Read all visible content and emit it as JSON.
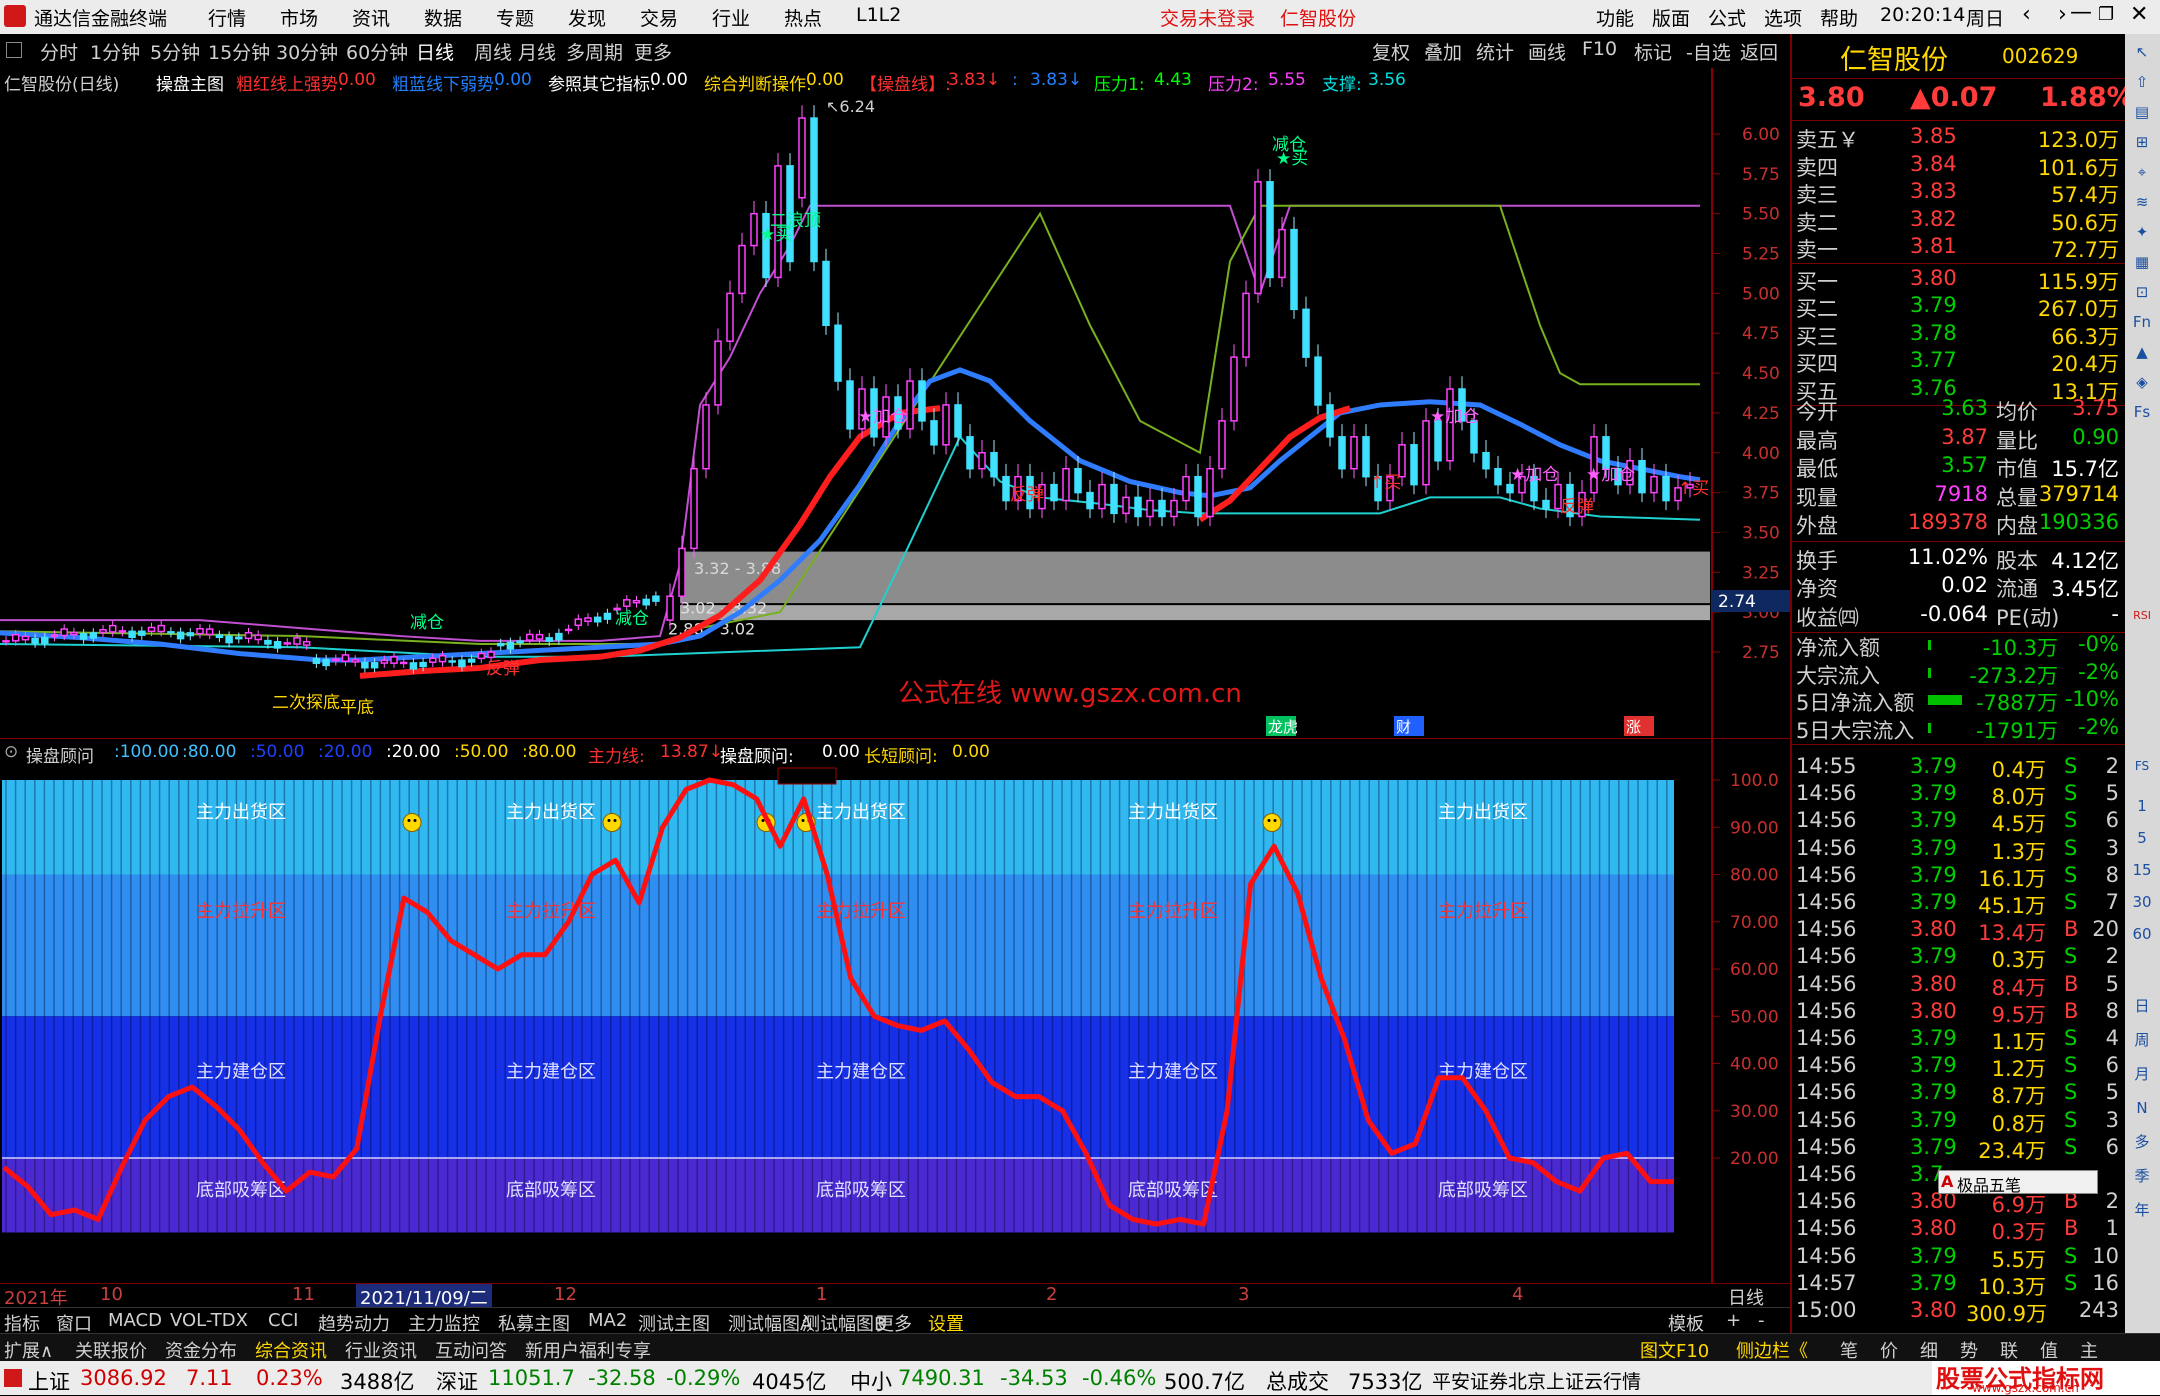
{
  "topbar": {
    "app_title": "通达信金融终端",
    "menus": [
      "行情",
      "市场",
      "资讯",
      "数据",
      "专题",
      "发现",
      "交易",
      "行业",
      "热点",
      "L1L2"
    ],
    "login_status": "交易未登录",
    "stock_title": "仁智股份",
    "right_menus": [
      "功能",
      "版面",
      "公式",
      "选项",
      "帮助"
    ],
    "time": "20:20:14",
    "weekday": "周日"
  },
  "periodbar": {
    "periods": [
      "分时",
      "1分钟",
      "5分钟",
      "15分钟",
      "30分钟",
      "60分钟",
      "日线",
      "周线",
      "月线",
      "多周期",
      "更多"
    ],
    "selected": "日线",
    "tools": [
      "复权",
      "叠加",
      "统计",
      "画线",
      "F10",
      "标记",
      "-自选",
      "返回"
    ]
  },
  "main_legend": {
    "stock": "仁智股份(日线)",
    "formula": "操盘主图",
    "items": [
      {
        "label": "粗红线上强势:",
        "value": "0.00",
        "color": "#ff3030"
      },
      {
        "label": "粗蓝线下弱势:",
        "value": "0.00",
        "color": "#2080ff"
      },
      {
        "label": "参照其它指标:",
        "value": "0.00",
        "color": "#ffffff"
      },
      {
        "label": "综合判断操作:",
        "value": "0.00",
        "color": "#ffd800"
      },
      {
        "label": "【操盘线】:",
        "value": "3.83↓",
        "color": "#ff3030"
      },
      {
        "label": ":",
        "value": "3.83↓",
        "color": "#2080ff"
      },
      {
        "label": "压力1:",
        "value": "4.43",
        "color": "#00ff00"
      },
      {
        "label": "压力2:",
        "value": "5.55",
        "color": "#ff40ff"
      },
      {
        "label": "支撑:",
        "value": "3.56",
        "color": "#00e0e0"
      }
    ]
  },
  "main_axis": {
    "ticks": [
      "6.00",
      "5.75",
      "5.50",
      "5.25",
      "5.00",
      "4.75",
      "4.50",
      "4.25",
      "4.00",
      "3.75",
      "3.50",
      "3.25",
      "3.00",
      "2.75"
    ],
    "current_label": "2.74"
  },
  "main_annotations": {
    "high_label": "6.24",
    "zone1": "3.32 - 3.88",
    "zone2": "3.02 - 3.32",
    "low_label": "2.88 - 3.02",
    "watermark": "公式在线  www.gszx.com.cn",
    "markers": [
      "减仓",
      "减仓",
      "减仓",
      "二浪顶",
      "★买",
      "★买",
      "★加仓",
      "★加仓",
      "★加仓",
      "★加仓",
      "反弹",
      "反弹",
      "反弹",
      "↑买",
      "↑买",
      "平底",
      "二次探底"
    ],
    "event_tags": [
      "龙虎",
      "财",
      "涨"
    ]
  },
  "sub_legend": {
    "name": "操盘顾问",
    "levels": [
      {
        "v": "100.00",
        "c": "#40c0ff"
      },
      {
        "v": "80.00",
        "c": "#40c0ff"
      },
      {
        "v": "50.00",
        "c": "#2040ff"
      },
      {
        "v": "20.00",
        "c": "#2040ff"
      },
      {
        "v": "20.00",
        "c": "#ffffff"
      },
      {
        "v": "50.00",
        "c": "#ffd800"
      },
      {
        "v": "80.00",
        "c": "#ffd800"
      }
    ],
    "zhuli_label": "主力线:",
    "zhuli_value": "13.87↓",
    "advisor_label": "操盘顾问:",
    "advisor_value": "0.00",
    "long_short_label": "长短顾问:",
    "long_short_value": "0.00"
  },
  "sub_axis": {
    "ticks": [
      "100.0",
      "90.00",
      "80.00",
      "70.00",
      "60.00",
      "50.00",
      "40.00",
      "30.00",
      "20.00"
    ]
  },
  "sub_zones": {
    "chuhuo": "主力出货区",
    "lasheng": "主力拉升区",
    "jiancang": "主力建仓区",
    "xichou": "底部吸筹区"
  },
  "chart_data": {
    "type": "line",
    "title": "操盘顾问",
    "series": [
      {
        "name": "主力线",
        "values": [
          18,
          14,
          8,
          9,
          7,
          18,
          28,
          33,
          35,
          31,
          26,
          19,
          13,
          17,
          16,
          22,
          50,
          75,
          72,
          66,
          63,
          60,
          63,
          63,
          70,
          80,
          83,
          74,
          90,
          98,
          100,
          99,
          96,
          86,
          96,
          80,
          58,
          50,
          48,
          47,
          49,
          43,
          36,
          33,
          33,
          30,
          21,
          10,
          7,
          6,
          7,
          6,
          30,
          78,
          86,
          76,
          58,
          45,
          28,
          21,
          23,
          37,
          37,
          30,
          20,
          19,
          15,
          13,
          20,
          21,
          15,
          15
        ]
      }
    ],
    "ylim": [
      0,
      100
    ]
  },
  "datebar": {
    "labels": [
      "2021年",
      "10",
      "11",
      "2021/11/09/二",
      "12",
      "1",
      "2",
      "3",
      "4"
    ],
    "period": "日线"
  },
  "tabbar": {
    "tabs": [
      "指标",
      "窗口",
      "MACD",
      "VOL-TDX",
      "CCI",
      "趋势动力",
      "主力监控",
      "私募主图",
      "MA2",
      "测试主图",
      "测试幅图A",
      "测试幅图B",
      "更多",
      "设置"
    ],
    "right": [
      "模板",
      "+",
      "-"
    ]
  },
  "infobar": {
    "items": [
      "扩展∧",
      "关联报价",
      "资金分布",
      "综合资讯",
      "行业资讯",
      "互动问答",
      "新用户福利专享"
    ],
    "right": [
      "图文F10",
      "侧边栏《",
      "笔",
      "价",
      "细",
      "势",
      "联",
      "值",
      "主"
    ]
  },
  "statusbar": {
    "sh_label": "上证",
    "sh_value": "3086.92",
    "sh_chg": "7.11",
    "sh_pct": "0.23%",
    "sh_amt": "3488亿",
    "sz_label": "深证",
    "sz_value": "11051.7",
    "sz_chg": "-32.58",
    "sz_pct": "-0.29%",
    "sz_amt": "4045亿",
    "zx_label": "中小",
    "zx_value": "7490.31",
    "zx_chg": "-34.53",
    "zx_pct": "-0.46%",
    "zx_amt": "500.7亿",
    "total_label": "总成交",
    "total_value": "7533亿",
    "source": "平安证券北京上证云行情",
    "brand": "股票公式指标网",
    "brand_url": "www.gszx.com.cn"
  },
  "quote": {
    "name": "仁智股份",
    "code": "002629",
    "price": "3.80",
    "change": "▲0.07",
    "pct": "1.88%",
    "asks": [
      {
        "l": "卖五￥",
        "p": "3.85",
        "v": "123.0万"
      },
      {
        "l": "卖四",
        "p": "3.84",
        "v": "101.6万"
      },
      {
        "l": "卖三",
        "p": "3.83",
        "v": "57.4万"
      },
      {
        "l": "卖二",
        "p": "3.82",
        "v": "50.6万"
      },
      {
        "l": "卖一",
        "p": "3.81",
        "v": "72.7万"
      }
    ],
    "bids": [
      {
        "l": "买一",
        "p": "3.80",
        "v": "115.9万"
      },
      {
        "l": "买二",
        "p": "3.79",
        "v": "267.0万"
      },
      {
        "l": "买三",
        "p": "3.78",
        "v": "66.3万"
      },
      {
        "l": "买四",
        "p": "3.77",
        "v": "20.4万"
      },
      {
        "l": "买五",
        "p": "3.76",
        "v": "13.1万"
      }
    ],
    "stats": [
      {
        "a": "今开",
        "av": "3.63",
        "ac": "#00d000",
        "b": "均价",
        "bv": "3.75",
        "bc": "#ff3b3b"
      },
      {
        "a": "最高",
        "av": "3.87",
        "ac": "#ff3b3b",
        "b": "量比",
        "bv": "0.90",
        "bc": "#00d000"
      },
      {
        "a": "最低",
        "av": "3.57",
        "ac": "#00d000",
        "b": "市值",
        "bv": "15.7亿",
        "bc": "#ffffff"
      },
      {
        "a": "现量",
        "av": "7918",
        "ac": "#ff40ff",
        "b": "总量",
        "bv": "379714",
        "bc": "#ffd800"
      },
      {
        "a": "外盘",
        "av": "189378",
        "ac": "#ff3b3b",
        "b": "内盘",
        "bv": "190336",
        "bc": "#00d000"
      }
    ],
    "stats2": [
      {
        "a": "换手",
        "av": "11.02%",
        "b": "股本",
        "bv": "4.12亿"
      },
      {
        "a": "净资",
        "av": "0.02",
        "b": "流通",
        "bv": "3.45亿"
      },
      {
        "a": "收益㈣",
        "av": "-0.064",
        "b": "PE(动)",
        "bv": "-"
      }
    ],
    "flows": [
      {
        "l": "净流入额",
        "v": "-10.3万",
        "p": "-0%"
      },
      {
        "l": "大宗流入",
        "v": "-273.2万",
        "p": "-2%"
      },
      {
        "l": "5日净流入额",
        "v": "-7887万",
        "p": "-10%"
      },
      {
        "l": "5日大宗流入",
        "v": "-1791万",
        "p": "-2%"
      }
    ],
    "ticks": [
      {
        "t": "14:55",
        "p": "3.79",
        "v": "0.4万",
        "s": "S",
        "n": "2"
      },
      {
        "t": "14:56",
        "p": "3.79",
        "v": "8.0万",
        "s": "S",
        "n": "5"
      },
      {
        "t": "14:56",
        "p": "3.79",
        "v": "4.5万",
        "s": "S",
        "n": "6"
      },
      {
        "t": "14:56",
        "p": "3.79",
        "v": "1.3万",
        "s": "S",
        "n": "3"
      },
      {
        "t": "14:56",
        "p": "3.79",
        "v": "16.1万",
        "s": "S",
        "n": "8"
      },
      {
        "t": "14:56",
        "p": "3.79",
        "v": "45.1万",
        "s": "S",
        "n": "7"
      },
      {
        "t": "14:56",
        "p": "3.80",
        "v": "13.4万",
        "s": "B",
        "n": "20"
      },
      {
        "t": "14:56",
        "p": "3.79",
        "v": "0.3万",
        "s": "S",
        "n": "2"
      },
      {
        "t": "14:56",
        "p": "3.80",
        "v": "8.4万",
        "s": "B",
        "n": "5"
      },
      {
        "t": "14:56",
        "p": "3.80",
        "v": "9.5万",
        "s": "B",
        "n": "8"
      },
      {
        "t": "14:56",
        "p": "3.79",
        "v": "1.1万",
        "s": "S",
        "n": "4"
      },
      {
        "t": "14:56",
        "p": "3.79",
        "v": "1.2万",
        "s": "S",
        "n": "6"
      },
      {
        "t": "14:56",
        "p": "3.79",
        "v": "8.7万",
        "s": "S",
        "n": "5"
      },
      {
        "t": "14:56",
        "p": "3.79",
        "v": "0.8万",
        "s": "S",
        "n": "3"
      },
      {
        "t": "14:56",
        "p": "3.79",
        "v": "23.4万",
        "s": "S",
        "n": "6"
      },
      {
        "t": "14:56",
        "p": "3.7",
        "v": "",
        "s": "",
        "n": ""
      },
      {
        "t": "14:56",
        "p": "3.80",
        "v": "6.9万",
        "s": "B",
        "n": "2"
      },
      {
        "t": "14:56",
        "p": "3.80",
        "v": "0.3万",
        "s": "B",
        "n": "1"
      },
      {
        "t": "14:56",
        "p": "3.79",
        "v": "5.5万",
        "s": "S",
        "n": "10"
      },
      {
        "t": "14:57",
        "p": "3.79",
        "v": "10.3万",
        "s": "S",
        "n": "16"
      },
      {
        "t": "15:00",
        "p": "3.80",
        "v": "300.9万",
        "s": "",
        "n": "243"
      }
    ],
    "popup": "极品五笔"
  },
  "rtools": {
    "labels": [
      "日",
      "周",
      "月",
      "N",
      "多",
      "季",
      "年"
    ],
    "nums": [
      "1",
      "5",
      "15",
      "30",
      "60"
    ],
    "rsi": "RSI",
    "fs": "FS"
  }
}
